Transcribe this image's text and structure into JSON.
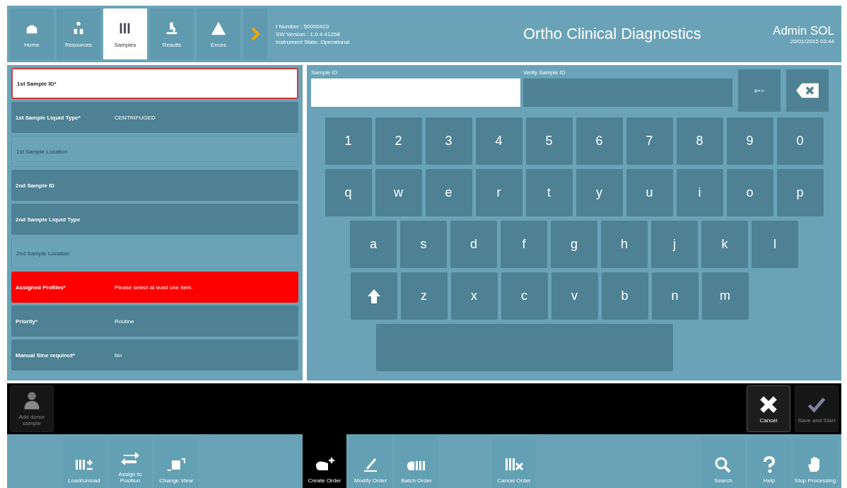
{
  "tabs": [
    {
      "label": "Home",
      "kind": "home",
      "selected": false
    },
    {
      "label": "Resources",
      "kind": "resources",
      "selected": false
    },
    {
      "label": "Samples",
      "kind": "samples",
      "selected": true
    },
    {
      "label": "Results",
      "kind": "results",
      "selected": false
    },
    {
      "label": "Errors",
      "kind": "errors",
      "selected": false
    }
  ],
  "instrument_info": [
    "I Number :  50000423",
    "SW Version :  1.0.4.41258",
    "Instrument State: Operational"
  ],
  "brand": "Ortho Clinical Diagnostics",
  "user": {
    "name": "Admin SOL",
    "datetime": "20/01/2015 03:44"
  },
  "form_rows": [
    {
      "label": "1st Sample ID*",
      "selected": true,
      "disabled": false,
      "error": false
    },
    {
      "label": "1st Sample Liquid Type*",
      "value": "CENTRIFUGED",
      "selected": false,
      "disabled": false,
      "error": false
    },
    {
      "label": "1st Sample Location",
      "selected": false,
      "disabled": true,
      "error": false
    },
    {
      "label": "2nd Sample ID",
      "selected": false,
      "disabled": false,
      "error": false
    },
    {
      "label": "2nd Sample Liquid Type",
      "selected": false,
      "disabled": false,
      "error": false
    },
    {
      "label": "2nd Sample Location",
      "selected": false,
      "disabled": true,
      "error": false
    },
    {
      "label": "Assigned Profiles*",
      "value": "Please select at least one item.",
      "selected": false,
      "disabled": false,
      "error": true
    },
    {
      "label": "Priority*",
      "value": "Routine",
      "selected": false,
      "disabled": false,
      "error": false
    },
    {
      "label": "Manual Sine required*",
      "value": "No",
      "selected": false,
      "disabled": false,
      "error": false
    }
  ],
  "keyboard": {
    "sample_id_label": "Sample ID",
    "verify_label": "Verify Sample ID",
    "symbols_key": "#+=",
    "rows": [
      [
        {
          "kind": "char",
          "label": "1"
        },
        {
          "kind": "char",
          "label": "2"
        },
        {
          "kind": "char",
          "label": "3"
        },
        {
          "kind": "char",
          "label": "4"
        },
        {
          "kind": "char",
          "label": "5"
        },
        {
          "kind": "char",
          "label": "6"
        },
        {
          "kind": "char",
          "label": "7"
        },
        {
          "kind": "char",
          "label": "8"
        },
        {
          "kind": "char",
          "label": "9"
        },
        {
          "kind": "char",
          "label": "0"
        }
      ],
      [
        {
          "kind": "char",
          "label": "q"
        },
        {
          "kind": "char",
          "label": "w"
        },
        {
          "kind": "char",
          "label": "e"
        },
        {
          "kind": "char",
          "label": "r"
        },
        {
          "kind": "char",
          "label": "t"
        },
        {
          "kind": "char",
          "label": "y"
        },
        {
          "kind": "char",
          "label": "u"
        },
        {
          "kind": "char",
          "label": "i"
        },
        {
          "kind": "char",
          "label": "o"
        },
        {
          "kind": "char",
          "label": "p"
        }
      ],
      [
        {
          "kind": "char",
          "label": "a"
        },
        {
          "kind": "char",
          "label": "s"
        },
        {
          "kind": "char",
          "label": "d"
        },
        {
          "kind": "char",
          "label": "f"
        },
        {
          "kind": "char",
          "label": "g"
        },
        {
          "kind": "char",
          "label": "h"
        },
        {
          "kind": "char",
          "label": "j"
        },
        {
          "kind": "char",
          "label": "k"
        },
        {
          "kind": "char",
          "label": "l"
        }
      ],
      [
        {
          "kind": "shift"
        },
        {
          "kind": "char",
          "label": "z"
        },
        {
          "kind": "char",
          "label": "x"
        },
        {
          "kind": "char",
          "label": "c"
        },
        {
          "kind": "char",
          "label": "v"
        },
        {
          "kind": "char",
          "label": "b"
        },
        {
          "kind": "char",
          "label": "n"
        },
        {
          "kind": "char",
          "label": "m"
        }
      ]
    ]
  },
  "action_bar": [
    {
      "label": "Add donor sample",
      "kind": "donor",
      "disabled": true
    },
    {
      "label": "Cancel",
      "kind": "cancel",
      "disabled": false
    },
    {
      "label": "Save and Start",
      "kind": "check",
      "disabled": true
    }
  ],
  "toolbar": [
    {
      "label": "Load/Unload",
      "kind": "load",
      "selected": false
    },
    {
      "label": "Assign to Position",
      "kind": "assign",
      "selected": false
    },
    {
      "label": "Change View",
      "kind": "view",
      "selected": false
    },
    {
      "label": "Create Order",
      "kind": "create",
      "selected": true
    },
    {
      "label": "Modify Order",
      "kind": "modify",
      "selected": false
    },
    {
      "label": "Batch Order",
      "kind": "batch",
      "selected": false
    },
    {
      "label": "Cancel Order",
      "kind": "cancelorder",
      "selected": false
    },
    {
      "label": "Search",
      "kind": "search",
      "selected": false
    },
    {
      "label": "Help",
      "kind": "help",
      "selected": false
    },
    {
      "label": "Stop Processing",
      "kind": "stop",
      "selected": false
    }
  ]
}
